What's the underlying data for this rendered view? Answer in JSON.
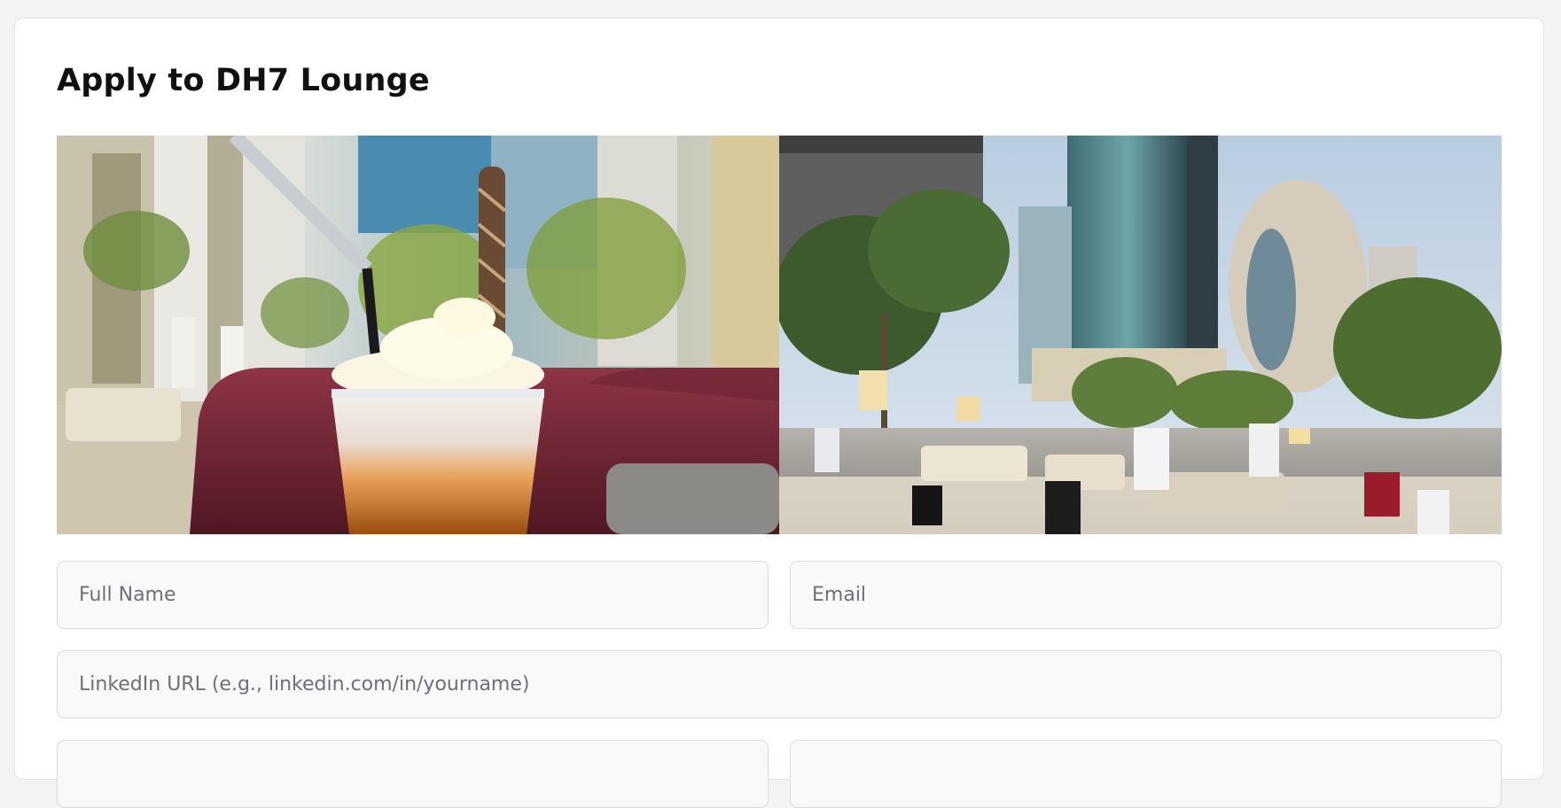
{
  "page": {
    "title": "Apply to DH7 Lounge"
  },
  "gallery": {
    "images": [
      {
        "subject": "iced frappe with whipped cream and wafer stick on a maroon lounge sofa, city towers blurred behind"
      },
      {
        "subject": "busy outdoor rooftop lounge terrace with palm trees, lamps and glass towers"
      }
    ]
  },
  "form": {
    "full_name": {
      "placeholder": "Full Name",
      "value": ""
    },
    "email": {
      "placeholder": "Email",
      "value": ""
    },
    "linkedin": {
      "placeholder": "LinkedIn URL (e.g., linkedin.com/in/yourname)",
      "value": ""
    },
    "next_left": {
      "placeholder": "",
      "value": ""
    },
    "next_right": {
      "placeholder": "",
      "value": ""
    }
  },
  "colors": {
    "page_bg": "#f2f3f5",
    "card_bg": "#ffffff",
    "field_bg": "#f8f9fb",
    "field_border": "#d9dce1",
    "placeholder": "#6c7079",
    "title": "#111111"
  }
}
